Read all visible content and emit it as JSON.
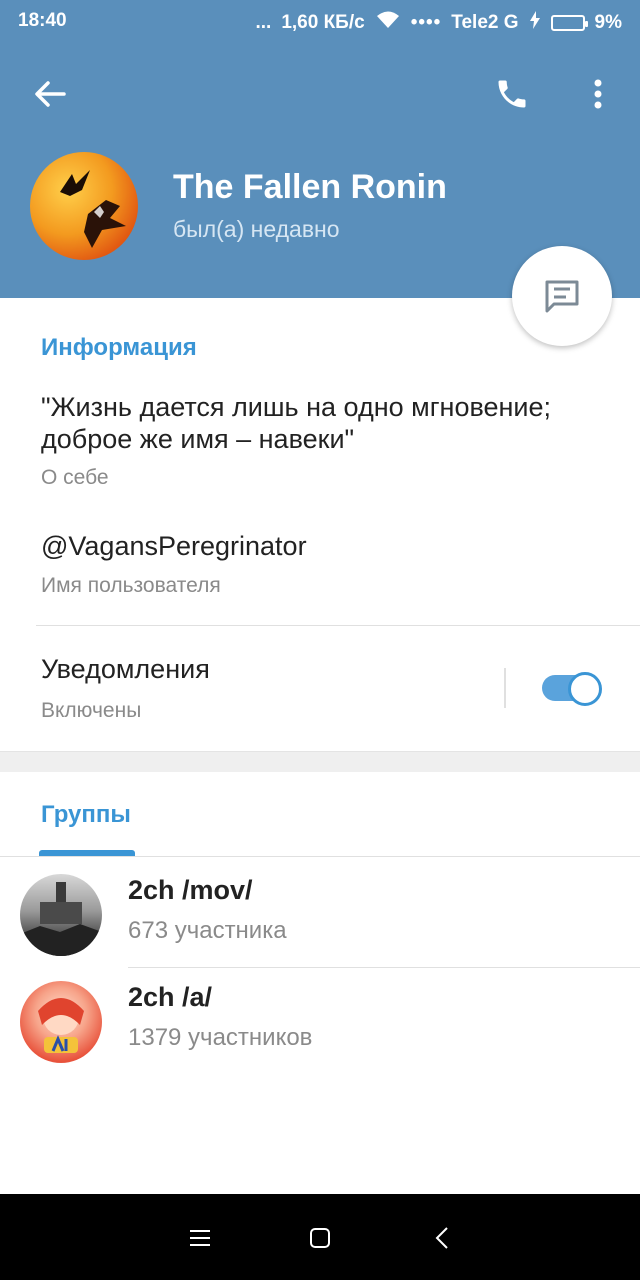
{
  "status_bar": {
    "time": "18:40",
    "dots": "...",
    "speed": "1,60 КБ/с",
    "carrier": "Tele2 G",
    "battery": "9%"
  },
  "header": {
    "name": "The Fallen Ronin",
    "status": "был(а) недавно"
  },
  "info": {
    "section_title": "Информация",
    "bio_line1": "\"Жизнь дается лишь на одно мгновение;",
    "bio_line2": "доброе же имя – навеки\"",
    "bio_label": "О себе",
    "username": "@VagansPeregrinator",
    "username_label": "Имя пользователя",
    "notifications_title": "Уведомления",
    "notifications_status": "Включены",
    "notifications_on": true
  },
  "groups": {
    "tab_label": "Группы",
    "items": [
      {
        "name": "2ch /mov/",
        "members": "673 участника"
      },
      {
        "name": "2ch /a/",
        "members": "1379 участников"
      }
    ]
  },
  "colors": {
    "header": "#5a8fbb",
    "accent": "#3a95d5"
  }
}
